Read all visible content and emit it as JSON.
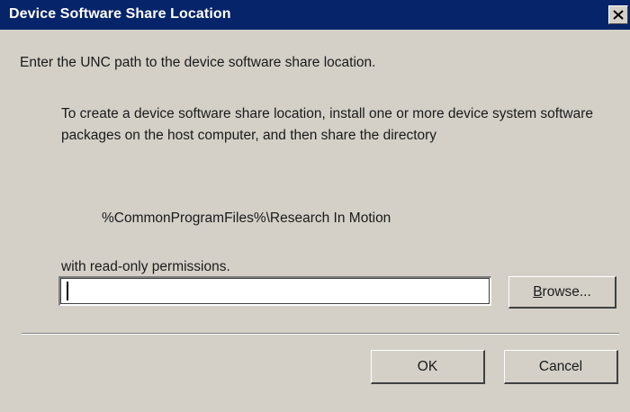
{
  "window": {
    "title": "Device Software Share Location",
    "close_icon": "close-icon"
  },
  "content": {
    "intro": "Enter the UNC path to the device software share location.",
    "instructions": "To create a device software share location, install one or more device system software packages on the host computer, and then share the directory",
    "path": "%CommonProgramFiles%\\Research In Motion",
    "permissions": "with read-only permissions."
  },
  "unc_input": {
    "value": "",
    "placeholder": ""
  },
  "buttons": {
    "browse_label": "Browse...",
    "ok_label": "OK",
    "cancel_label": "Cancel"
  },
  "colors": {
    "titlebar": "#06246a",
    "dialog_background": "#d4d0c8"
  }
}
